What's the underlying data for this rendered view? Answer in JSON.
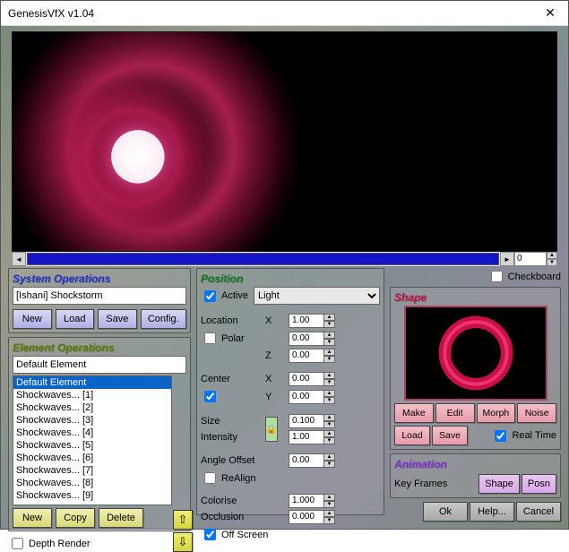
{
  "title": "GenesisVfX v1.04",
  "preview_coord": "0",
  "checkboard_label": "Checkboard",
  "checkboard_checked": false,
  "system": {
    "title": "System Operations",
    "preset_name": "[Ishani] Shockstorm",
    "buttons": {
      "new": "New",
      "load": "Load",
      "save": "Save",
      "config": "Config."
    }
  },
  "elements": {
    "title": "Element Operations",
    "current": "Default Element",
    "items": [
      "Default Element",
      "Shockwaves... [1]",
      "Shockwaves... [2]",
      "Shockwaves... [3]",
      "Shockwaves... [4]",
      "Shockwaves... [5]",
      "Shockwaves... [6]",
      "Shockwaves... [7]",
      "Shockwaves... [8]",
      "Shockwaves... [9]"
    ],
    "selected_index": 0,
    "buttons": {
      "new": "New",
      "copy": "Copy",
      "delete": "Delete"
    },
    "depth_render_label": "Depth Render",
    "depth_render_checked": false
  },
  "position": {
    "title": "Position",
    "active_label": "Active",
    "active_checked": true,
    "mode": "Light",
    "labels": {
      "location": "Location",
      "polar": "Polar",
      "center": "Center",
      "size": "Size",
      "intensity": "Intensity",
      "angle_offset": "Angle Offset",
      "realign": "ReAlign",
      "colorise": "Colorise",
      "occlusion": "Occlusion",
      "off_screen": "Off Screen"
    },
    "polar_checked": false,
    "center_checked": true,
    "realign_checked": false,
    "off_screen_checked": true,
    "axis": {
      "X": "X",
      "Z": "Z",
      "Y": "Y"
    },
    "values": {
      "loc_x": "1.00",
      "loc_z": "0.00",
      "loc_z2": "0.00",
      "center_x": "0.00",
      "center_y": "0.00",
      "size": "0.100",
      "intensity": "1.00",
      "angle": "0.00",
      "colorise": "1.000",
      "occlusion": "0.000"
    }
  },
  "shape": {
    "title": "Shape",
    "buttons": {
      "make": "Make",
      "edit": "Edit",
      "morph": "Morph",
      "noise": "Noise",
      "load": "Load",
      "save": "Save"
    },
    "real_time_label": "Real Time",
    "real_time_checked": true
  },
  "animation": {
    "title": "Animation",
    "key_frames_label": "Key Frames",
    "buttons": {
      "shape": "Shape",
      "posn": "Posn"
    }
  },
  "final": {
    "ok": "Ok",
    "help": "Help...",
    "cancel": "Cancel"
  }
}
